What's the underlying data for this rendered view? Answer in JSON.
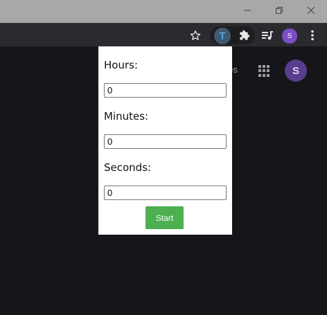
{
  "window_controls": {
    "minimize_icon": "minimize-icon",
    "restore_icon": "restore-icon",
    "close_icon": "close-icon"
  },
  "toolbar": {
    "extension_letter": "T",
    "profile_initial": "S",
    "icons": [
      "star-icon",
      "puzzle-icon",
      "media-queue-icon",
      "kebab-menu-icon"
    ]
  },
  "background_page": {
    "partial_text": "ges",
    "avatar_initial": "S"
  },
  "popup": {
    "hours": {
      "label": "Hours:",
      "value": "0"
    },
    "minutes": {
      "label": "Minutes:",
      "value": "0"
    },
    "seconds": {
      "label": "Seconds:",
      "value": "0"
    },
    "start_label": "Start",
    "start_color": "#4caf50"
  },
  "colors": {
    "page_background": "#161519",
    "toolbar_background": "#2b2b2f",
    "titlebar_background": "#a8a8a8",
    "profile_purple": "#7a4fc2"
  }
}
